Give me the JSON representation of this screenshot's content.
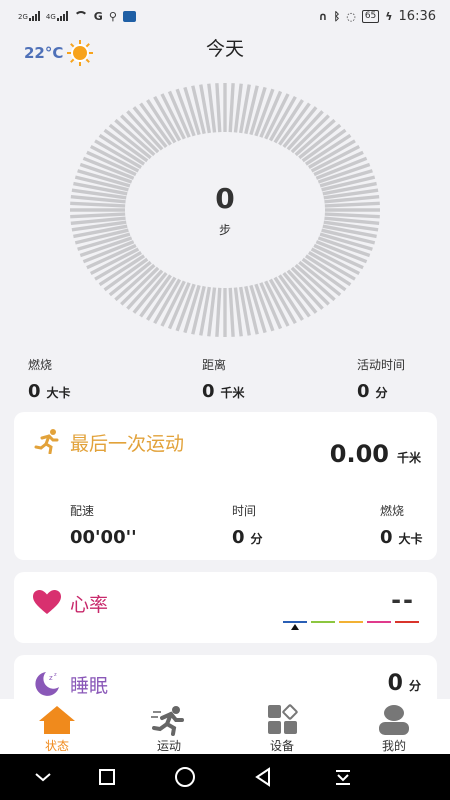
{
  "status_bar": {
    "network1": "2G",
    "network2": "4G",
    "battery": "65",
    "time": "16:36"
  },
  "header": {
    "temperature": "22°C",
    "weather_icon": "sun-icon",
    "title": "今天"
  },
  "steps": {
    "value": "0",
    "unit": "步"
  },
  "summary": {
    "burn": {
      "label": "燃烧",
      "value": "0",
      "unit": "大卡"
    },
    "distance": {
      "label": "距离",
      "value": "0",
      "unit": "千米"
    },
    "active_time": {
      "label": "活动时间",
      "value": "0",
      "unit": "分"
    }
  },
  "last_exercise": {
    "title": "最后一次运动",
    "icon": "runner-icon",
    "distance": "0.00",
    "distance_unit": "千米",
    "pace": {
      "label": "配速",
      "value": "00'00''"
    },
    "time": {
      "label": "时间",
      "value": "0",
      "unit": "分"
    },
    "burn": {
      "label": "燃烧",
      "value": "0",
      "unit": "大卡"
    }
  },
  "heart_rate": {
    "title": "心率",
    "icon": "heart-icon",
    "value": "--",
    "scale_colors": [
      "#2a5fb5",
      "#8cc63f",
      "#f2b134",
      "#e03a8c",
      "#d9342b"
    ]
  },
  "sleep": {
    "title": "睡眠",
    "icon": "moon-icon",
    "value": "0",
    "unit": "分"
  },
  "tabs": [
    {
      "label": "状态",
      "icon": "home-icon",
      "active": true
    },
    {
      "label": "运动",
      "icon": "running-icon",
      "active": false
    },
    {
      "label": "设备",
      "icon": "device-grid-icon",
      "active": false
    },
    {
      "label": "我的",
      "icon": "profile-icon",
      "active": false
    }
  ],
  "colors": {
    "accent": "#f08a1c",
    "exercise": "#e2a23a",
    "heart": "#c8286b",
    "sleep": "#8a58b8",
    "ring": "#c9c9cc"
  }
}
